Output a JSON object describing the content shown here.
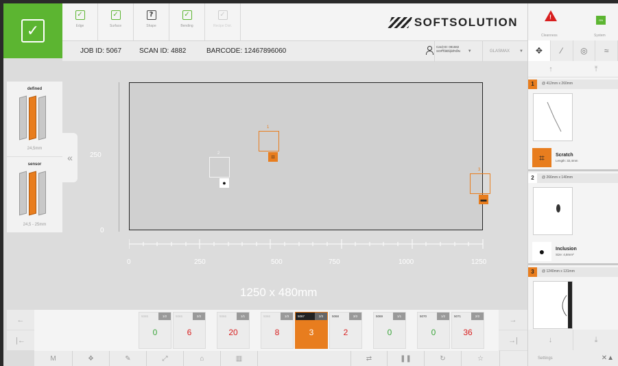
{
  "status": {
    "ok_icon": "check-icon"
  },
  "checks": [
    {
      "label": "Edge",
      "icon": "check",
      "state": "ok"
    },
    {
      "label": "Surface",
      "icon": "check",
      "state": "ok"
    },
    {
      "label": "Shape",
      "icon": "question",
      "state": "unknown"
    },
    {
      "label": "Bending",
      "icon": "check",
      "state": "ok"
    },
    {
      "label": "Recipe Dist.",
      "icon": "check",
      "state": "disabled"
    }
  ],
  "brand": "SOFTSOLUTION",
  "info": {
    "job_id": "JOB ID: 5067",
    "scan_id": "SCAN ID: 4882",
    "barcode": "BARCODE: 12467896060",
    "card_id": "Card-ID: 081582",
    "card_org": "SOFTSOLUTION",
    "recipe": "Recipe 4",
    "glass": "GLASMAX"
  },
  "right_header": {
    "cleanness": "Cleanness",
    "system": "System",
    "system_badge": "ON"
  },
  "left_panel": {
    "defined_title": "defined",
    "defined_value": "24,5mm",
    "sensor_title": "sensor",
    "sensor_value": "24,5 - 25mm",
    "collapse_icon": "«"
  },
  "canvas": {
    "y_ticks": [
      "250",
      "0"
    ],
    "x_ticks": [
      "0",
      "250",
      "500",
      "750",
      "1000",
      "1250"
    ],
    "dimensions": "1250 x 480mm",
    "defects": [
      {
        "num": "1",
        "color": "#e87d1e"
      },
      {
        "num": "2",
        "color": "#f5f5f5"
      },
      {
        "num": "3",
        "color": "#e87d1e"
      }
    ]
  },
  "defect_list": [
    {
      "num": "1",
      "size": "@ 412mm x 260mm",
      "name": "Scratch",
      "sub": "Length: 32,4mm",
      "color": "#e87d1e"
    },
    {
      "num": "2",
      "size": "@ 266mm x 140mm",
      "name": "Inclusion",
      "sub": "Size: 4,8mm²",
      "color": "#ffffff"
    },
    {
      "num": "3",
      "size": "@ 1240mm x 131mm",
      "color": "#e87d1e"
    }
  ],
  "strip": [
    {
      "id": "5065",
      "frac": "1/2",
      "value": "0",
      "color": "#3aa53a"
    },
    {
      "id": "5065",
      "frac": "2/2",
      "value": "6",
      "color": "#d82020"
    },
    {
      "id": "5066",
      "frac": "1/1",
      "value": "20",
      "color": "#d82020"
    },
    {
      "id": "5066",
      "frac": "1/3",
      "value": "8",
      "color": "#d82020"
    },
    {
      "id": "5067",
      "frac": "2/3",
      "value": "3",
      "color": "#ffffff",
      "active": true
    },
    {
      "id": "5068",
      "frac": "3/3",
      "value": "2",
      "color": "#d82020"
    },
    {
      "id": "5069",
      "frac": "1/1",
      "value": "0",
      "color": "#3aa53a"
    },
    {
      "id": "5070",
      "frac": "1/2",
      "value": "0",
      "color": "#3aa53a"
    },
    {
      "id": "5071",
      "frac": "2/2",
      "value": "36",
      "color": "#d82020"
    }
  ],
  "nav": {
    "prev": "←",
    "first": "|←",
    "next": "→",
    "last": "→|",
    "up": "↑",
    "top": "⤒",
    "down": "↓",
    "bottom": "⤓"
  },
  "toolbar": {
    "m_label": "M",
    "settings": "Settings"
  }
}
